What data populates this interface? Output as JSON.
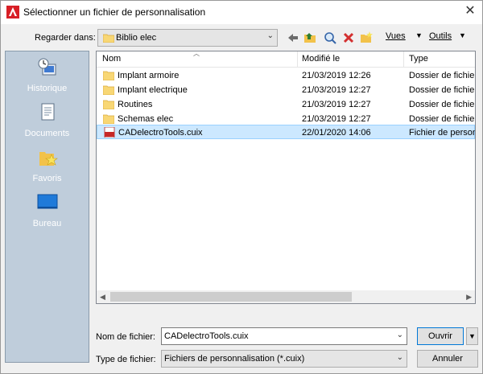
{
  "window": {
    "title": "Sélectionner un fichier de personnalisation",
    "close_glyph": "✕"
  },
  "toolbar": {
    "lookin_label": "Regarder dans:",
    "lookin_value": "Biblio elec",
    "views_label": "Vues",
    "tools_label": "Outils",
    "icons": [
      "back-arrow-icon",
      "up-folder-icon",
      "search-web-icon",
      "delete-icon",
      "new-folder-icon"
    ]
  },
  "places": [
    {
      "label": "Historique",
      "icon": "history-icon"
    },
    {
      "label": "Documents",
      "icon": "documents-icon"
    },
    {
      "label": "Favoris",
      "icon": "favorites-icon"
    },
    {
      "label": "Bureau",
      "icon": "desktop-icon"
    }
  ],
  "columns": [
    "Nom",
    "Modifié le",
    "Type"
  ],
  "files": [
    {
      "name": "Implant armoire",
      "date": "21/03/2019 12:26",
      "type": "Dossier de fichiers",
      "kind": "folder"
    },
    {
      "name": "Implant electrique",
      "date": "21/03/2019 12:27",
      "type": "Dossier de fichiers",
      "kind": "folder"
    },
    {
      "name": "Routines",
      "date": "21/03/2019 12:27",
      "type": "Dossier de fichiers",
      "kind": "folder"
    },
    {
      "name": "Schemas elec",
      "date": "21/03/2019 12:27",
      "type": "Dossier de fichiers",
      "kind": "folder"
    },
    {
      "name": "CADelectroTools.cuix",
      "date": "22/01/2020 14:06",
      "type": "Fichier de personnalisation",
      "kind": "cuix",
      "selected": true
    }
  ],
  "filename": {
    "label": "Nom de fichier:",
    "value": "CADelectroTools.cuix"
  },
  "filetype": {
    "label": "Type de fichier:",
    "value": "Fichiers de personnalisation (*.cuix)"
  },
  "buttons": {
    "open": "Ouvrir",
    "cancel": "Annuler"
  },
  "colors": {
    "selection": "#cce8ff",
    "places_bg": "#bfcddb",
    "folder": "#f8d775",
    "accent": "#0078d7"
  }
}
